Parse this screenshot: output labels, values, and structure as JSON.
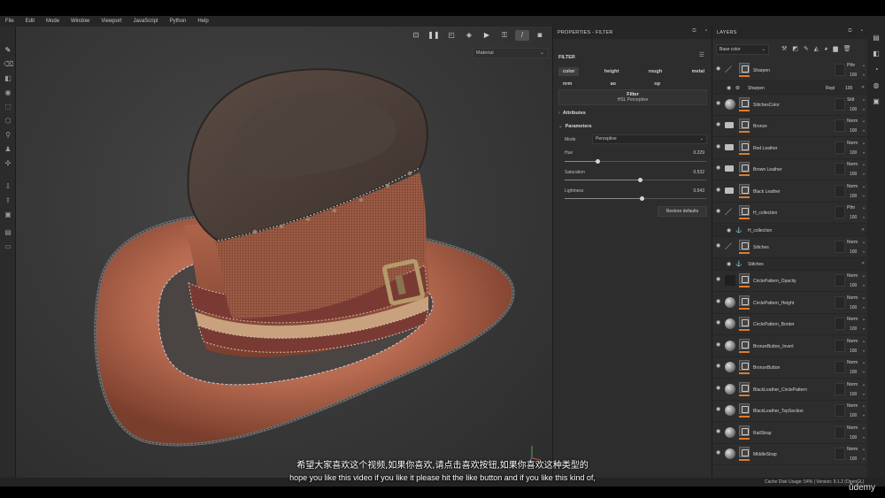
{
  "menu": [
    "File",
    "Edit",
    "Mode",
    "Window",
    "Viewport",
    "JavaScript",
    "Python",
    "Help"
  ],
  "viewport": {
    "material_select": "Material",
    "toolbar_icons": [
      "camera-reset-icon",
      "pause-icon",
      "frame-icon",
      "cube-icon",
      "video-camera-icon",
      "lock-icon",
      "brush-icon",
      "screenshot-icon"
    ]
  },
  "properties": {
    "title": "PROPERTIES - FILTER",
    "section": "FILTER",
    "channels_row1": [
      "color",
      "height",
      "rough",
      "metal"
    ],
    "channels_row2": [
      "nrm",
      "ao",
      "op"
    ],
    "filter_title": "Filter",
    "filter_name": "HSL Perceptive",
    "attributes_label": "Attributes",
    "parameters_label": "Parameters",
    "mode_label": "Mode",
    "mode_value": "Perceptive",
    "params": [
      {
        "label": "Hue",
        "value": "0.229",
        "level": 0.229
      },
      {
        "label": "Saturation",
        "value": "0.532",
        "level": 0.532
      },
      {
        "label": "Lightness",
        "value": "0.543",
        "level": 0.543
      }
    ],
    "restore_label": "Restore defaults"
  },
  "layers": {
    "title": "LAYERS",
    "channel_select": "Base color",
    "items": [
      {
        "kind": "fill",
        "name": "Sharpen",
        "thumb": "brush",
        "mode": "Pthr",
        "opacity": "100"
      },
      {
        "kind": "sub",
        "name": "Sharpen",
        "mode": "Repl",
        "opacity": "100"
      },
      {
        "kind": "fill",
        "name": "StitchesColor",
        "thumb": "sphere",
        "mode": "Sklt",
        "opacity": "100"
      },
      {
        "kind": "folder",
        "name": "Bronze",
        "mode": "Norm",
        "opacity": "100"
      },
      {
        "kind": "folder",
        "name": "Red Leather",
        "mode": "Norm",
        "opacity": "100"
      },
      {
        "kind": "folder",
        "name": "Brown Leather",
        "mode": "Norm",
        "opacity": "100"
      },
      {
        "kind": "folder",
        "name": "Black Leather",
        "mode": "Norm",
        "opacity": "100"
      },
      {
        "kind": "fill",
        "name": "H_collection",
        "thumb": "brush",
        "mode": "Pthr",
        "opacity": "100"
      },
      {
        "kind": "sub",
        "name": "H_collection",
        "mode": "",
        "opacity": ""
      },
      {
        "kind": "fill",
        "name": "Stitches",
        "thumb": "brush",
        "mode": "Norm",
        "opacity": "100"
      },
      {
        "kind": "sub",
        "name": "Stitches",
        "mode": "",
        "opacity": ""
      },
      {
        "kind": "fill",
        "name": "CirclePattern_Opacity",
        "thumb": "dark",
        "mode": "Norm",
        "opacity": "100"
      },
      {
        "kind": "fill",
        "name": "CirclePattern_Height",
        "thumb": "sphere",
        "mode": "Norm",
        "opacity": "100"
      },
      {
        "kind": "fill",
        "name": "CirclePattern_Border",
        "thumb": "sphere",
        "mode": "Norm",
        "opacity": "100"
      },
      {
        "kind": "fill",
        "name": "BronzeButton_Invert",
        "thumb": "sphere",
        "mode": "Norm",
        "opacity": "100"
      },
      {
        "kind": "fill",
        "name": "BronzeButton",
        "thumb": "sphere",
        "mode": "Norm",
        "opacity": "100"
      },
      {
        "kind": "fill",
        "name": "BlackLeather_CirclePattern",
        "thumb": "sphere",
        "mode": "Norm",
        "opacity": "100"
      },
      {
        "kind": "fill",
        "name": "BlackLeather_TopSection",
        "thumb": "sphere",
        "mode": "Norm",
        "opacity": "100"
      },
      {
        "kind": "fill",
        "name": "RailStrap",
        "thumb": "sphere",
        "mode": "Norm",
        "opacity": "100"
      },
      {
        "kind": "fill",
        "name": "MiddleStrap",
        "thumb": "sphere",
        "mode": "Norm",
        "opacity": "100"
      }
    ]
  },
  "status": "Cache Disk Usage:  54% | Version: 9.1.2 (OpenGL)",
  "subtitles": {
    "zh": "希望大家喜欢这个视频,如果你喜欢,请点击喜欢按钮,如果你喜欢这种类型的",
    "en": "hope you like this video if you like it please hit the like button and if you like this kind of,"
  },
  "watermark": "ûdemy",
  "colors": {
    "accent_bar": "#e07b2a",
    "panel_bg": "#2d2d2d",
    "viewport_bg": "#3a3a3a"
  }
}
